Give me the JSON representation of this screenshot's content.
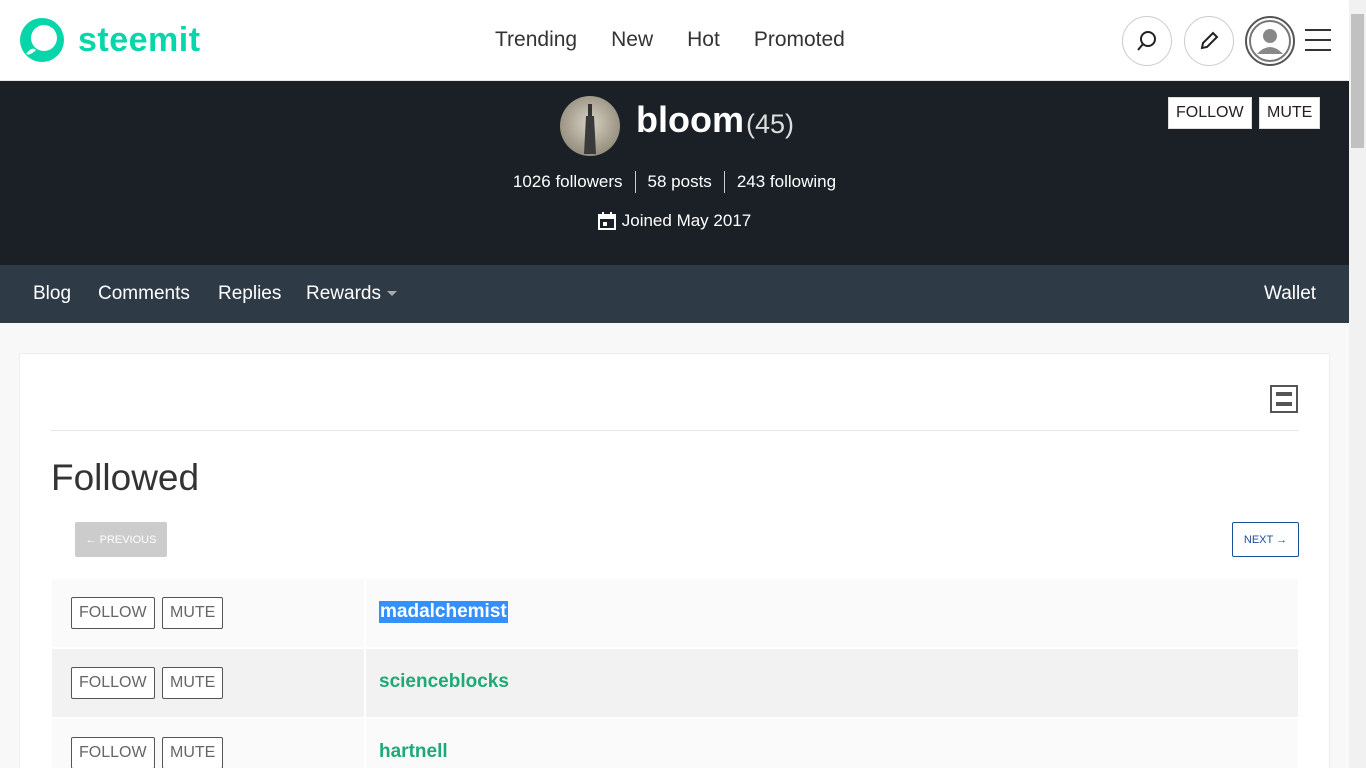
{
  "header": {
    "brand": "steemit",
    "nav": [
      "Trending",
      "New",
      "Hot",
      "Promoted"
    ],
    "accent_color": "#06d6a9",
    "icons": [
      "search-icon",
      "pencil-icon",
      "user-avatar-icon",
      "hamburger-icon"
    ]
  },
  "profile": {
    "name": "bloom",
    "reputation": "(45)",
    "followers": "1026 followers",
    "posts": "58 posts",
    "following": "243 following",
    "joined": "Joined May 2017",
    "follow_label": "FOLLOW",
    "mute_label": "MUTE"
  },
  "subnav": {
    "items": [
      "Blog",
      "Comments",
      "Replies",
      "Rewards"
    ],
    "wallet": "Wallet"
  },
  "content": {
    "title": "Followed",
    "prev_label": "← PREVIOUS",
    "next_label": "NEXT →",
    "rows": [
      {
        "follow": "FOLLOW",
        "mute": "MUTE",
        "user": "madalchemist",
        "selected": true
      },
      {
        "follow": "FOLLOW",
        "mute": "MUTE",
        "user": "scienceblocks",
        "selected": false
      },
      {
        "follow": "FOLLOW",
        "mute": "MUTE",
        "user": "hartnell",
        "selected": false
      }
    ]
  }
}
